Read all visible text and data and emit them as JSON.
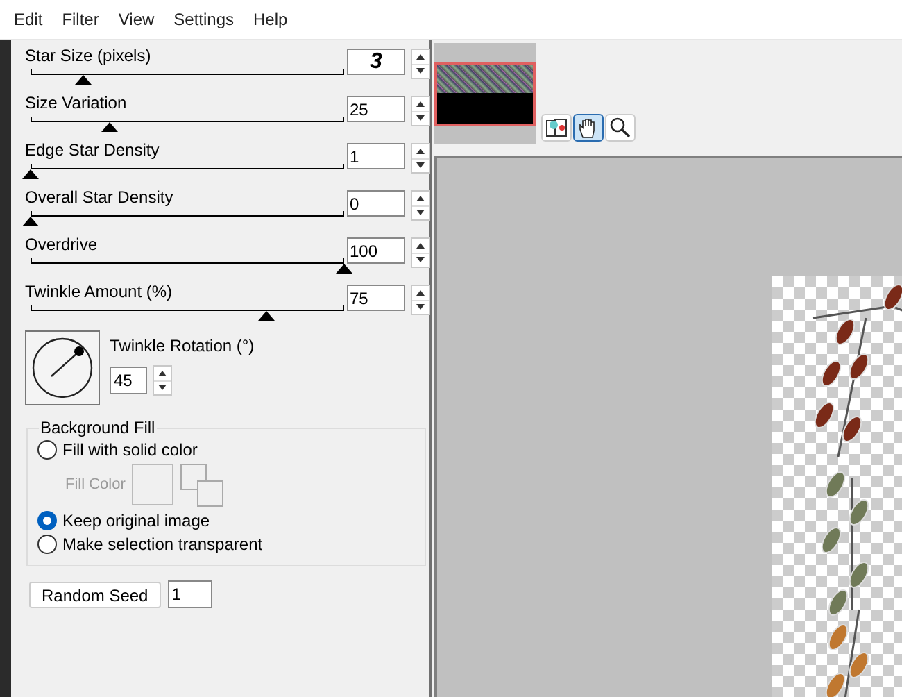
{
  "menu": [
    "Edit",
    "Filter",
    "View",
    "Settings",
    "Help"
  ],
  "sliders": [
    {
      "label": "Star Size (pixels)",
      "value": "3",
      "level": 0.17,
      "emphasized": true
    },
    {
      "label": "Size Variation",
      "value": "25",
      "level": 0.25,
      "emphasized": false
    },
    {
      "label": "Edge Star Density",
      "value": "1",
      "level": 0,
      "emphasized": false
    },
    {
      "label": "Overall Star Density",
      "value": "0",
      "level": 0,
      "emphasized": false
    },
    {
      "label": "Overdrive",
      "value": "100",
      "level": 1,
      "emphasized": false
    },
    {
      "label": "Twinkle Amount (%)",
      "value": "75",
      "level": 0.75,
      "emphasized": false
    }
  ],
  "rotation": {
    "label": "Twinkle Rotation (°)",
    "value": "45"
  },
  "background_fill": {
    "title": "Background Fill",
    "options": [
      {
        "label": "Fill with solid color",
        "selected": false
      },
      {
        "label": "Keep original image",
        "selected": true
      },
      {
        "label": "Make selection transparent",
        "selected": false
      }
    ],
    "fill_color": {
      "label": "Fill Color",
      "disabled": true
    }
  },
  "random_seed": {
    "button": "Random Seed",
    "value": "1"
  },
  "tools": [
    {
      "kind": "tile",
      "selected": false
    },
    {
      "kind": "hand",
      "selected": true
    },
    {
      "kind": "zoom",
      "selected": false
    }
  ]
}
